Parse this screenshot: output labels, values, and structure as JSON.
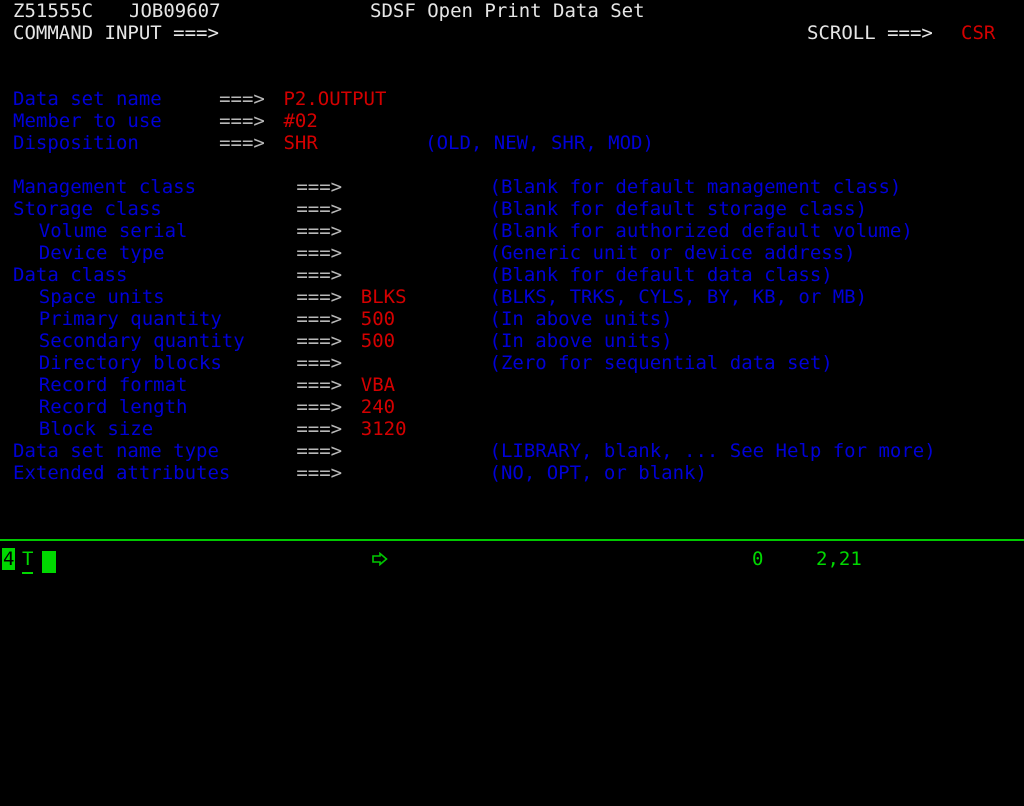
{
  "screen": {
    "title": "SDSF Open Print Data Set",
    "session_id": "Z51555C",
    "job_id": "JOB09607",
    "command_label": "COMMAND INPUT ===>",
    "command_value": "",
    "scroll_label": "SCROLL ===>",
    "scroll_value": "CSR",
    "arrow": "===>"
  },
  "fields": [
    {
      "label": "Data set name",
      "indent": 0,
      "arrow_col": 16,
      "value": "P2.OUTPUT",
      "comment": "",
      "comment_col": 37
    },
    {
      "label": "Member to use",
      "indent": 0,
      "arrow_col": 16,
      "value": "#02",
      "comment": "",
      "comment_col": 37
    },
    {
      "label": "Disposition",
      "indent": 0,
      "arrow_col": 16,
      "value": "SHR",
      "comment": "(OLD, NEW, SHR, MOD)",
      "comment_col": 32
    },
    {
      "label": "",
      "indent": 0,
      "arrow_col": 0,
      "value": "",
      "comment": "",
      "comment_col": 0
    },
    {
      "label": "Management class",
      "indent": 0,
      "arrow_col": 22,
      "value": "",
      "comment": "(Blank for default management class)",
      "comment_col": 37
    },
    {
      "label": "Storage class",
      "indent": 0,
      "arrow_col": 22,
      "value": "",
      "comment": "(Blank for default storage class)",
      "comment_col": 37
    },
    {
      "label": "Volume serial",
      "indent": 2,
      "arrow_col": 22,
      "value": "",
      "comment": "(Blank for authorized default volume)",
      "comment_col": 37
    },
    {
      "label": "Device type",
      "indent": 2,
      "arrow_col": 22,
      "value": "",
      "comment": "(Generic unit or device address)",
      "comment_col": 37
    },
    {
      "label": "Data class",
      "indent": 0,
      "arrow_col": 22,
      "value": "",
      "comment": "(Blank for default data class)",
      "comment_col": 37
    },
    {
      "label": "Space units",
      "indent": 2,
      "arrow_col": 22,
      "value": "BLKS",
      "comment": "(BLKS, TRKS, CYLS, BY, KB, or MB)",
      "comment_col": 37
    },
    {
      "label": "Primary quantity",
      "indent": 2,
      "arrow_col": 22,
      "value": "500",
      "comment": "(In above units)",
      "comment_col": 37
    },
    {
      "label": "Secondary quantity",
      "indent": 2,
      "arrow_col": 22,
      "value": "500",
      "comment": "(In above units)",
      "comment_col": 37
    },
    {
      "label": "Directory blocks",
      "indent": 2,
      "arrow_col": 22,
      "value": "",
      "comment": "(Zero for sequential data set)",
      "comment_col": 37
    },
    {
      "label": "Record format",
      "indent": 2,
      "arrow_col": 22,
      "value": "VBA",
      "comment": "",
      "comment_col": 37
    },
    {
      "label": "Record length",
      "indent": 2,
      "arrow_col": 22,
      "value": "240",
      "comment": "",
      "comment_col": 37
    },
    {
      "label": "Block size",
      "indent": 2,
      "arrow_col": 22,
      "value": "3120",
      "comment": "",
      "comment_col": 37
    },
    {
      "label": "Data set name type",
      "indent": 0,
      "arrow_col": 22,
      "value": "",
      "comment": "(LIBRARY, blank, ... See Help for more)",
      "comment_col": 37
    },
    {
      "label": "Extended attributes",
      "indent": 0,
      "arrow_col": 22,
      "value": "",
      "comment": "(NO, OPT, or blank)",
      "comment_col": 37
    }
  ],
  "status_bar": {
    "session_number": "4",
    "session_letter": "T",
    "indicator_icon": "right-arrow-icon",
    "error_count": "0",
    "cursor_position": "2,21"
  },
  "colors": {
    "background": "#000000",
    "label": "#0000d8",
    "value": "#d40000",
    "heading": "#e6e6e6",
    "arrow": "#b9b9b9",
    "status": "#00d800"
  }
}
